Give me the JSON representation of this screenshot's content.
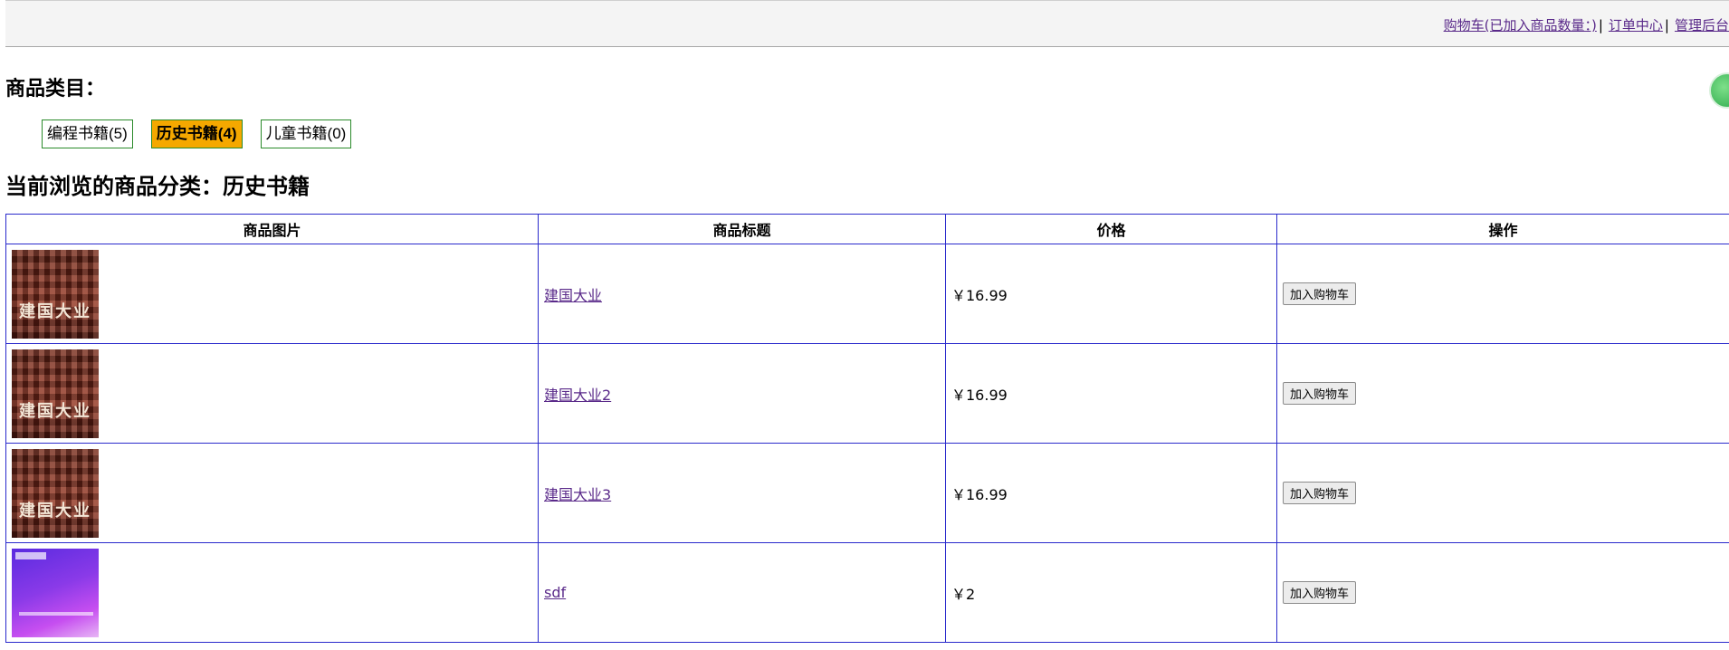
{
  "topnav": {
    "cart_label": "购物车(已加入商品数量：)",
    "orders_label": "订单中心",
    "admin_label": "管理后台",
    "separator": "|"
  },
  "categories": {
    "heading": "商品类目：",
    "items": [
      {
        "label": "编程书籍(5)",
        "active": false
      },
      {
        "label": "历史书籍(4)",
        "active": true
      },
      {
        "label": "儿童书籍(0)",
        "active": false
      }
    ]
  },
  "current": {
    "heading": "当前浏览的商品分类：历史书籍"
  },
  "table": {
    "headers": [
      "商品图片",
      "商品标题",
      "价格",
      "操作"
    ],
    "rows": [
      {
        "image": "poster",
        "poster_text": "建国大业",
        "title": "建国大业",
        "price": "￥16.99",
        "action": "加入购物车"
      },
      {
        "image": "poster",
        "poster_text": "建国大业",
        "title": "建国大业2",
        "price": "￥16.99",
        "action": "加入购物车"
      },
      {
        "image": "poster",
        "poster_text": "建国大业",
        "title": "建国大业3",
        "price": "￥16.99",
        "action": "加入购物车"
      },
      {
        "image": "purple",
        "poster_text": "",
        "title": "sdf",
        "price": "￥2",
        "action": "加入购物车"
      }
    ]
  },
  "colors": {
    "active_category": "#f5a800",
    "category_border": "#2a8a2a",
    "table_border": "#2a2acc",
    "link": "#5a2a8a"
  }
}
